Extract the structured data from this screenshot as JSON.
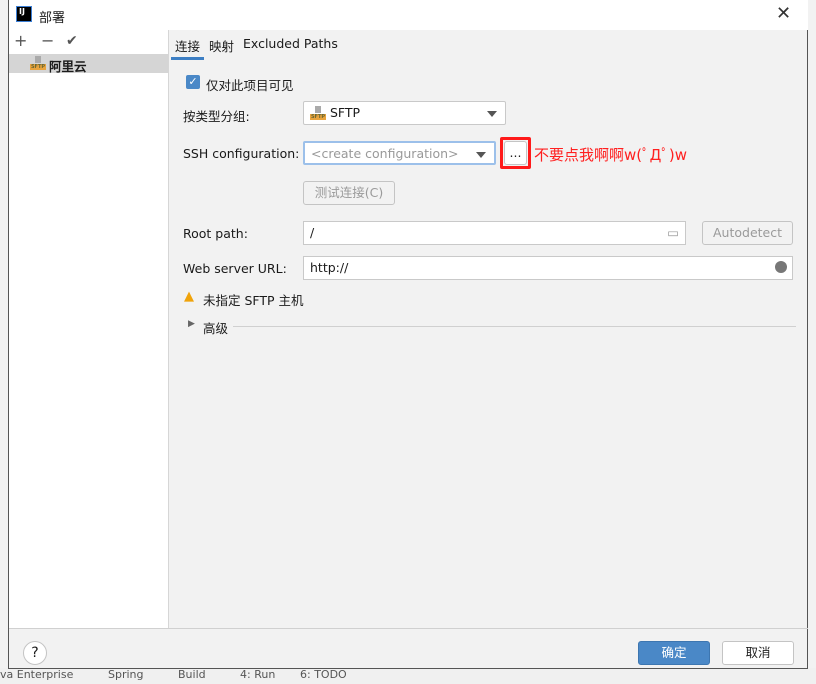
{
  "window": {
    "title": "部署",
    "close": "✕"
  },
  "background": {
    "statusbar": [
      "va Enterprise",
      "Spring",
      "Build",
      "4: Run",
      "6: TODO"
    ]
  },
  "left_panel": {
    "toolbar": {
      "add": "+",
      "remove": "−",
      "apply": "✔"
    },
    "servers": [
      {
        "name": "阿里云",
        "type": "SFTP",
        "selected": true
      }
    ]
  },
  "tabs": [
    {
      "label": "连接",
      "active": true
    },
    {
      "label": "映射"
    },
    {
      "label": "Excluded Paths"
    }
  ],
  "form": {
    "visible_only": {
      "label": "仅对此项目可见",
      "checked": true
    },
    "group_by_type": {
      "label": "按类型分组:",
      "value": "SFTP"
    },
    "ssh_config": {
      "label": "SSH configuration:",
      "placeholder": "<create configuration>",
      "browse": "..."
    },
    "annotation": {
      "text": "不要点我啊啊w(ﾟДﾟ)w",
      "color": "#ff0000"
    },
    "test_connection": "测试连接(C)",
    "root_path": {
      "label": "Root path:",
      "value": "/"
    },
    "autodetect": "Autodetect",
    "web_url": {
      "label": "Web server URL:",
      "value": "http://"
    },
    "warning": "未指定 SFTP 主机",
    "advanced": "高级"
  },
  "footer": {
    "help": "?",
    "ok": "确定",
    "cancel": "取消",
    "accent": "#4a88c7"
  }
}
